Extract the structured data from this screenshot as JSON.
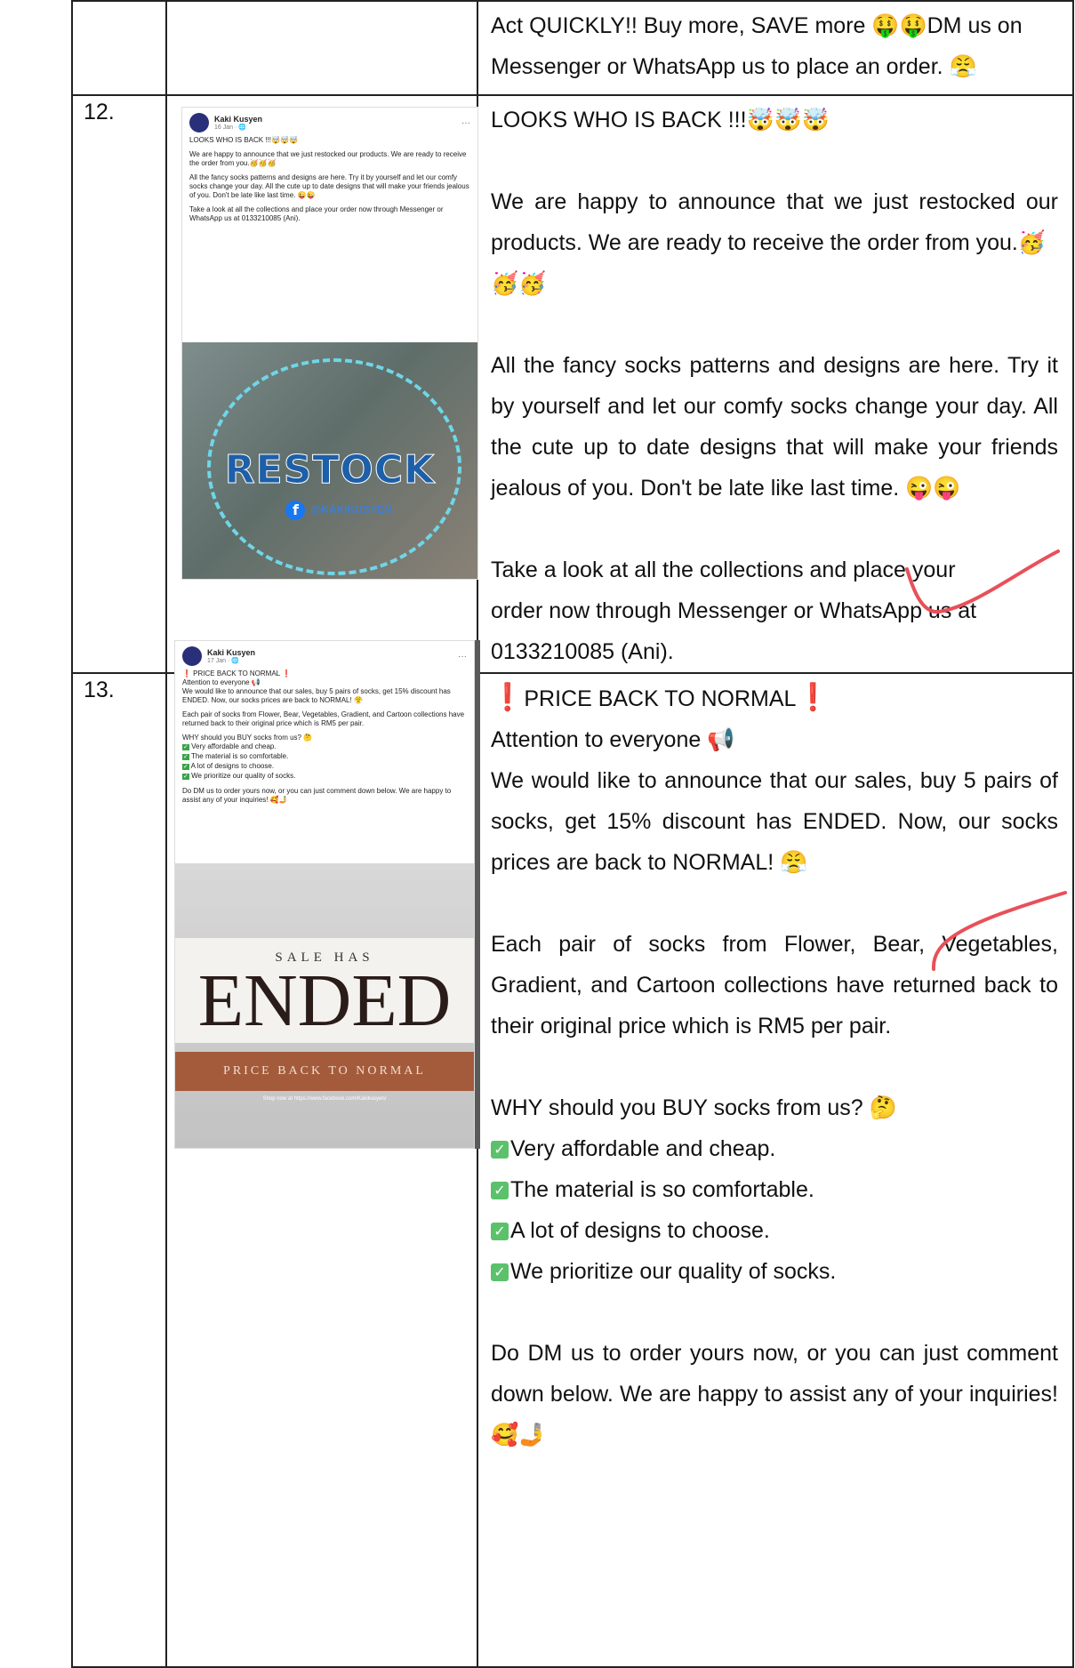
{
  "row_top": {
    "text_line1": "Act QUICKLY!! Buy more, SAVE more 🤑🤑DM us on",
    "text_line2": "Messenger or WhatsApp us to place an order. 😤"
  },
  "row12": {
    "number": "12.",
    "title": "LOOKS WHO IS BACK !!!🤯🤯🤯",
    "para1": "We are happy to announce that we just restocked our products. We are ready to receive the order from you.🥳",
    "para1_emoji": "🥳🥳",
    "para2": "All the fancy socks patterns and designs are here. Try it by yourself and let our comfy socks change your day. All the cute up to date designs that will make your friends jealous of you. Don't be late like last time. 😜😜",
    "para3": "Take a look at all the collections and place your order now through Messenger or WhatsApp us at",
    "para3_phone": "0133210085 (Ani).",
    "screenshot": {
      "page_name": "Kaki Kusyen",
      "date": "16 Jan · 🌐",
      "line1": "LOOKS WHO IS BACK !!!🤯🤯🤯",
      "line2": "We are happy to announce that we just restocked our products. We are ready to receive the order from you.🥳🥳🥳",
      "line3": "All the fancy socks patterns and designs are here. Try it by yourself and let our comfy socks change your day. All the cute up to date designs that will make your friends jealous of you. Don't be late like last time. 😜😜",
      "line4": "Take a look at all the collections and place your order now through Messenger or WhatsApp us at 0133210085 (Ani).",
      "image_word": "RESTOCK",
      "image_handle": "@KAKIKUSYEN",
      "menu": "···"
    }
  },
  "row13": {
    "number": "13.",
    "title": "PRICE BACK TO NORMAL",
    "title_mark": "❗",
    "attention": "Attention to everyone 📢",
    "para1": "We would like to announce that our sales, buy 5 pairs of socks, get 15% discount has ENDED. Now, our socks prices are back to NORMAL! 😤",
    "para2": "Each pair of socks from Flower, Bear, Vegetables, Gradient, and Cartoon collections have returned back to their original price which is RM5 per pair.",
    "why": "WHY should you BUY socks from us? 🤔",
    "check_mark": "✓",
    "benefits": [
      "Very affordable and cheap.",
      "The material is so comfortable.",
      "A lot of designs to choose.",
      "We prioritize our quality of socks."
    ],
    "closing": "Do DM us to order yours now, or you can just comment down below. We are happy to assist any of your inquiries! 🥰🤳",
    "screenshot": {
      "page_name": "Kaki Kusyen",
      "date": "17 Jan · 🌐",
      "menu": "···",
      "title": "❗ PRICE BACK TO NORMAL ❗",
      "attention": "Attention to everyone 📢",
      "para1": "We would like to announce that our sales, buy 5 pairs of socks, get 15% discount has ENDED. Now, our socks prices are back to NORMAL! 😤",
      "para2": "Each pair of socks from Flower, Bear, Vegetables, Gradient, and Cartoon collections have returned back to their original price which is RM5 per pair.",
      "why": "WHY should you BUY socks from us? 🤔",
      "b1": "Very affordable and cheap.",
      "b2": "The material is so comfortable.",
      "b3": "A lot of designs to choose.",
      "b4": "We prioritize our quality of socks.",
      "closing": "Do DM us to order yours now, or you can just comment down below. We are happy to assist any of your inquiries! 🥰🤳",
      "sale_has": "SALE HAS",
      "ended": "ENDED",
      "band": "PRICE BACK TO NORMAL",
      "shop": "Shop now at https://www.facebook.com/Kakikusyen/"
    }
  }
}
